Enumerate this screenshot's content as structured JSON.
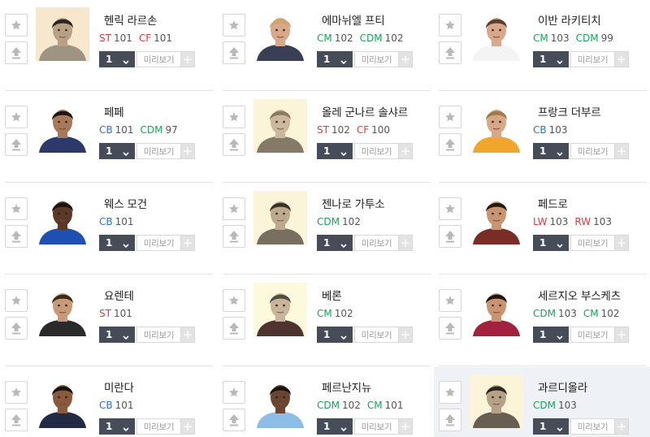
{
  "labels": {
    "preview": "미리보기",
    "plus": "+",
    "level": "1"
  },
  "colors": {
    "ST": "#e23b3b",
    "CF": "#e23b3b",
    "LW": "#e23b3b",
    "RW": "#e23b3b",
    "CM": "#19a35a",
    "CDM": "#19a35a",
    "CB": "#2f6fd0"
  },
  "players": [
    {
      "name": "헨릭 라르손",
      "positions": [
        {
          "pos": "ST",
          "ovr": "101"
        },
        {
          "pos": "CF",
          "ovr": "101"
        }
      ],
      "portrait": {
        "bg": "#d8cfbf",
        "skin": "#b88a66",
        "hair": "#2b2118",
        "shirt": "#8d8478",
        "sepia": true
      }
    },
    {
      "name": "에마뉘엘 프티",
      "positions": [
        {
          "pos": "CM",
          "ovr": "102"
        },
        {
          "pos": "CDM",
          "ovr": "102"
        }
      ],
      "portrait": {
        "bg": "#ffffff",
        "skin": "#d9a78a",
        "hair": "#caa56a",
        "shirt": "#3a3f55",
        "sepia": false
      }
    },
    {
      "name": "이반 라키티치",
      "positions": [
        {
          "pos": "CM",
          "ovr": "103"
        },
        {
          "pos": "CDM",
          "ovr": "99"
        }
      ],
      "portrait": {
        "bg": "#ffffff",
        "skin": "#d9a78a",
        "hair": "#5a3f2a",
        "shirt": "#f4f4f4",
        "sepia": false
      }
    },
    {
      "name": "페페",
      "positions": [
        {
          "pos": "CB",
          "ovr": "101"
        },
        {
          "pos": "CDM",
          "ovr": "97"
        }
      ],
      "portrait": {
        "bg": "#ffffff",
        "skin": "#a87858",
        "hair": "#1b1512",
        "shirt": "#2b3a6a",
        "sepia": false
      }
    },
    {
      "name": "올레 군나르 솔샤르",
      "positions": [
        {
          "pos": "ST",
          "ovr": "102"
        },
        {
          "pos": "CF",
          "ovr": "100"
        }
      ],
      "portrait": {
        "bg": "#e3dccd",
        "skin": "#c7a07e",
        "hair": "#8c6a44",
        "shirt": "#7d6b58",
        "sepia": true
      }
    },
    {
      "name": "프랑크 더부르",
      "positions": [
        {
          "pos": "CB",
          "ovr": "103"
        }
      ],
      "portrait": {
        "bg": "#ffffff",
        "skin": "#d8a886",
        "hair": "#a07a48",
        "shirt": "#f2a52b",
        "sepia": false
      }
    },
    {
      "name": "웨스 모건",
      "positions": [
        {
          "pos": "CB",
          "ovr": "101"
        }
      ],
      "portrait": {
        "bg": "#ffffff",
        "skin": "#5a3a26",
        "hair": "#1a1410",
        "shirt": "#1f4fb0",
        "sepia": false
      }
    },
    {
      "name": "젠나로 가투소",
      "positions": [
        {
          "pos": "CDM",
          "ovr": "102"
        }
      ],
      "portrait": {
        "bg": "#e3dccd",
        "skin": "#b89372",
        "hair": "#3a2b20",
        "shirt": "#6f6353",
        "sepia": true
      }
    },
    {
      "name": "페드로",
      "positions": [
        {
          "pos": "LW",
          "ovr": "103"
        },
        {
          "pos": "RW",
          "ovr": "103"
        }
      ],
      "portrait": {
        "bg": "#ffffff",
        "skin": "#c99570",
        "hair": "#24180f",
        "shirt": "#7a2d27",
        "sepia": false
      }
    },
    {
      "name": "요렌테",
      "positions": [
        {
          "pos": "ST",
          "ovr": "101"
        }
      ],
      "portrait": {
        "bg": "#ffffff",
        "skin": "#c99a78",
        "hair": "#3a2a1c",
        "shirt": "#2a2a2a",
        "sepia": false
      }
    },
    {
      "name": "베론",
      "positions": [
        {
          "pos": "CM",
          "ovr": "102"
        }
      ],
      "portrait": {
        "bg": "#e6e0d3",
        "skin": "#c49c7c",
        "hair": "#444",
        "shirt": "#6a1f1f",
        "sepia": true
      }
    },
    {
      "name": "세르지오 부스케츠",
      "positions": [
        {
          "pos": "CDM",
          "ovr": "103"
        },
        {
          "pos": "CM",
          "ovr": "102"
        }
      ],
      "portrait": {
        "bg": "#ffffff",
        "skin": "#c9946e",
        "hair": "#1e1510",
        "shirt": "#a3213d",
        "sepia": false
      }
    },
    {
      "name": "미란다",
      "positions": [
        {
          "pos": "CB",
          "ovr": "101"
        }
      ],
      "portrait": {
        "bg": "#ffffff",
        "skin": "#8a5a3c",
        "hair": "#1a1410",
        "shirt": "#222a44",
        "sepia": false
      }
    },
    {
      "name": "페르난지뉴",
      "positions": [
        {
          "pos": "CDM",
          "ovr": "102"
        },
        {
          "pos": "CM",
          "ovr": "101"
        }
      ],
      "portrait": {
        "bg": "#ffffff",
        "skin": "#6b4530",
        "hair": "#1a1410",
        "shirt": "#8bbde6",
        "sepia": false
      }
    },
    {
      "name": "과르디올라",
      "positions": [
        {
          "pos": "CDM",
          "ovr": "103"
        }
      ],
      "portrait": {
        "bg": "#e3dccd",
        "skin": "#b08c6c",
        "hair": "#2a211a",
        "shirt": "#5f5447",
        "sepia": true
      }
    }
  ]
}
